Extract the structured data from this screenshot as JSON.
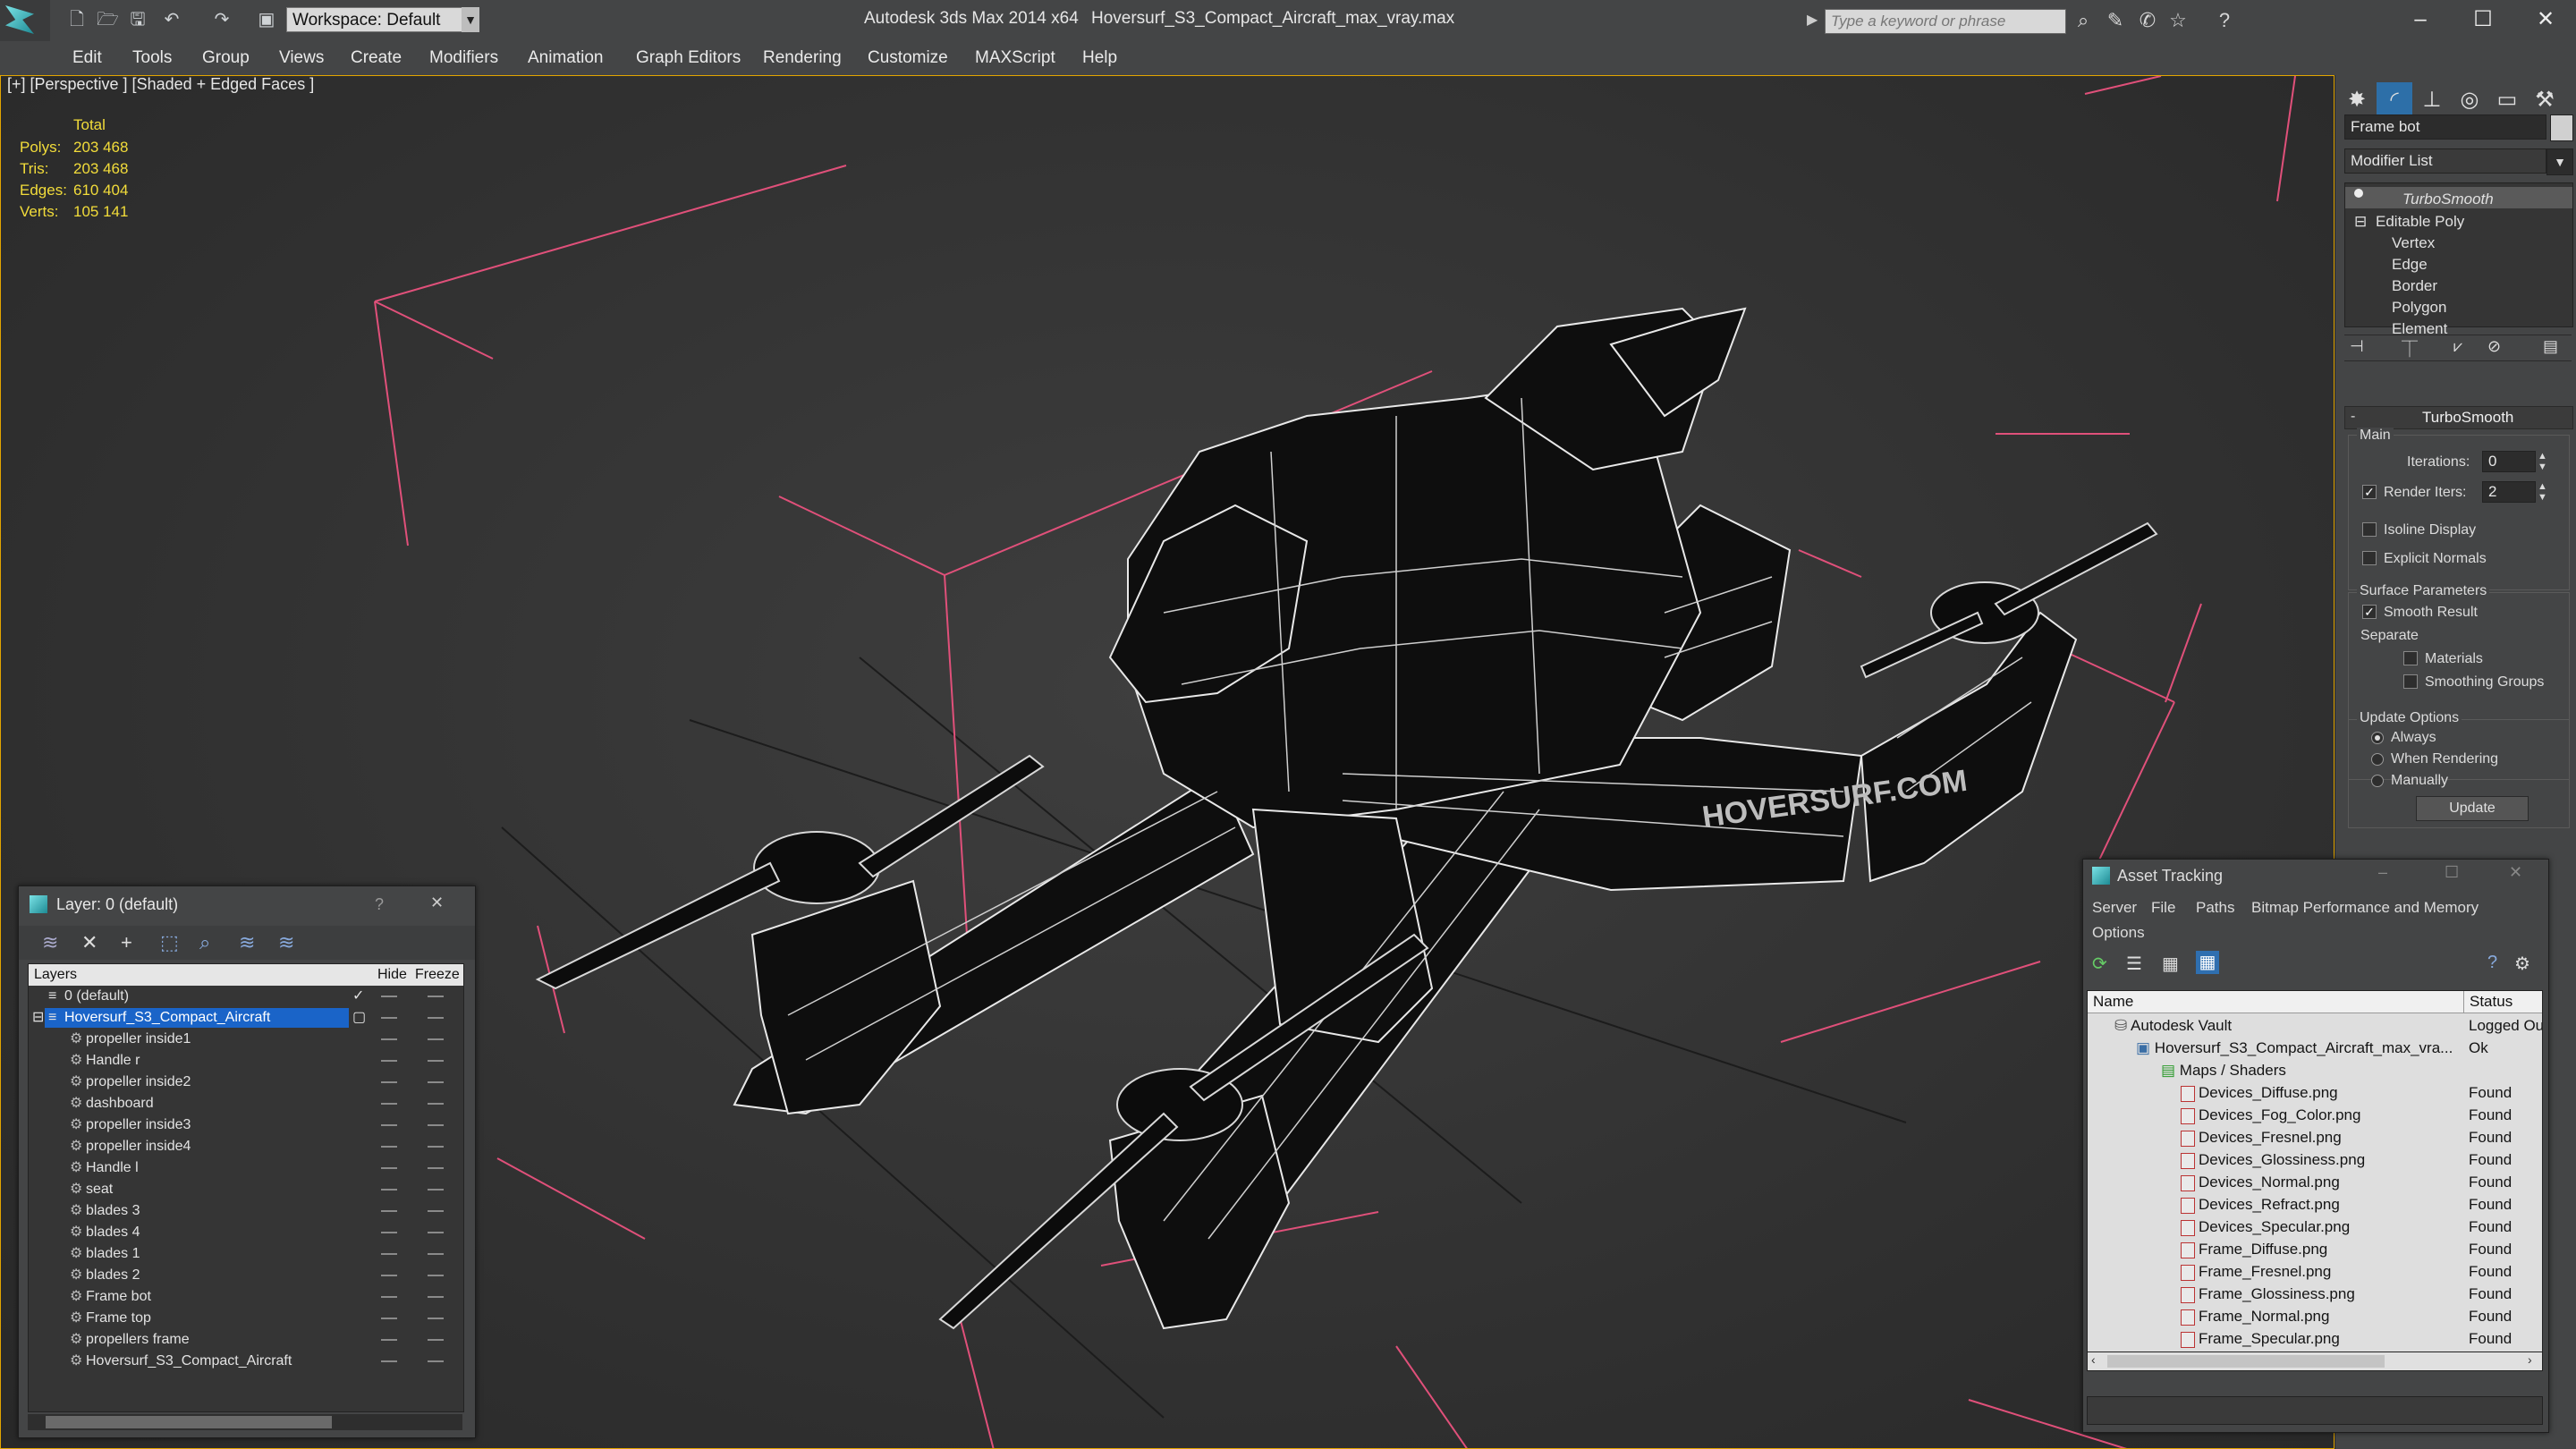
{
  "titlebar": {
    "workspace": "Workspace: Default",
    "app_title": "Autodesk 3ds Max 2014 x64",
    "doc_title": "Hoversurf_S3_Compact_Aircraft_max_vray.max",
    "search_placeholder": "Type a keyword or phrase"
  },
  "menu": [
    "Edit",
    "Tools",
    "Group",
    "Views",
    "Create",
    "Modifiers",
    "Animation",
    "Graph Editors",
    "Rendering",
    "Customize",
    "MAXScript",
    "Help"
  ],
  "viewport": {
    "label": "[+] [Perspective ] [Shaded + Edged Faces ]",
    "stats": {
      "header": "Total",
      "rows": [
        {
          "label": "Polys:",
          "value": "203 468"
        },
        {
          "label": "Tris:",
          "value": "203 468"
        },
        {
          "label": "Edges:",
          "value": "610 404"
        },
        {
          "label": "Verts:",
          "value": "105 141"
        }
      ]
    },
    "logo_text": "HOVERSURF.COM"
  },
  "command_panel": {
    "object_name": "Frame bot",
    "modifier_list": "Modifier List",
    "stack": {
      "top": "TurboSmooth",
      "base": "Editable Poly",
      "subobjects": [
        "Vertex",
        "Edge",
        "Border",
        "Polygon",
        "Element"
      ]
    },
    "turbosmooth": {
      "title": "TurboSmooth",
      "main_group": "Main",
      "iterations_label": "Iterations:",
      "iterations_value": "0",
      "render_iters_label": "Render Iters:",
      "render_iters_value": "2",
      "render_iters_checked": true,
      "isoline": "Isoline Display",
      "explicit": "Explicit Normals",
      "surface_group": "Surface Parameters",
      "smooth_result": "Smooth Result",
      "separate": "Separate",
      "materials": "Materials",
      "smoothing_groups": "Smoothing Groups",
      "update_group": "Update Options",
      "update_options": [
        "Always",
        "When Rendering",
        "Manually"
      ],
      "update_selected": "Always",
      "update_button": "Update"
    }
  },
  "layer_dialog": {
    "title": "Layer: 0 (default)",
    "help": "?",
    "columns": {
      "layers": "Layers",
      "hide": "Hide",
      "freeze": "Freeze"
    },
    "default_layer": "0 (default)",
    "selected_layer": "Hoversurf_S3_Compact_Aircraft",
    "objects": [
      "propeller inside1",
      "Handle r",
      "propeller inside2",
      "dashboard",
      "propeller inside3",
      "propeller inside4",
      "Handle l",
      "seat",
      "blades 3",
      "blades 4",
      "blades 1",
      "blades 2",
      "Frame bot",
      "Frame top",
      "propellers frame",
      "Hoversurf_S3_Compact_Aircraft"
    ]
  },
  "asset_dialog": {
    "title": "Asset Tracking",
    "menu": [
      "Server",
      "File",
      "Paths",
      "Bitmap Performance and Memory",
      "Options"
    ],
    "columns": {
      "name": "Name",
      "status": "Status"
    },
    "vault": {
      "name": "Autodesk Vault",
      "status": "Logged Ou"
    },
    "file": {
      "name": "Hoversurf_S3_Compact_Aircraft_max_vra...",
      "status": "Ok"
    },
    "maps_folder": "Maps / Shaders",
    "maps": [
      {
        "name": "Devices_Diffuse.png",
        "status": "Found"
      },
      {
        "name": "Devices_Fog_Color.png",
        "status": "Found"
      },
      {
        "name": "Devices_Fresnel.png",
        "status": "Found"
      },
      {
        "name": "Devices_Glossiness.png",
        "status": "Found"
      },
      {
        "name": "Devices_Normal.png",
        "status": "Found"
      },
      {
        "name": "Devices_Refract.png",
        "status": "Found"
      },
      {
        "name": "Devices_Specular.png",
        "status": "Found"
      },
      {
        "name": "Frame_Diffuse.png",
        "status": "Found"
      },
      {
        "name": "Frame_Fresnel.png",
        "status": "Found"
      },
      {
        "name": "Frame_Glossiness.png",
        "status": "Found"
      },
      {
        "name": "Frame_Normal.png",
        "status": "Found"
      },
      {
        "name": "Frame_Specular.png",
        "status": "Found"
      }
    ]
  },
  "colors": {
    "stats_yellow": "#f2dc3a",
    "selection_blue": "#1a64c8",
    "wire_pink": "#e0507a",
    "viewport_border": "#e2a500"
  }
}
